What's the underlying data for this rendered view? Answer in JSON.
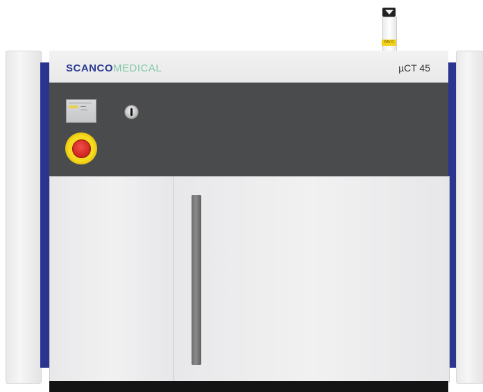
{
  "brand": {
    "name_main": "SCANCO",
    "name_sub": "MEDICAL"
  },
  "model": {
    "label": "µCT 45"
  },
  "beacon": {
    "label": "RAY O"
  },
  "colors": {
    "brand_blue": "#2b3a8f",
    "brand_green": "#7fc6a6",
    "side_strip_blue": "#2a3590",
    "control_band": "#4a4b4d",
    "estop_red": "#d42a24",
    "estop_yellow": "#f6dc1e",
    "beacon_yellow": "#f1d21a"
  },
  "icons": {
    "key_switch": "key-switch-icon",
    "emergency_stop": "emergency-stop-icon"
  }
}
